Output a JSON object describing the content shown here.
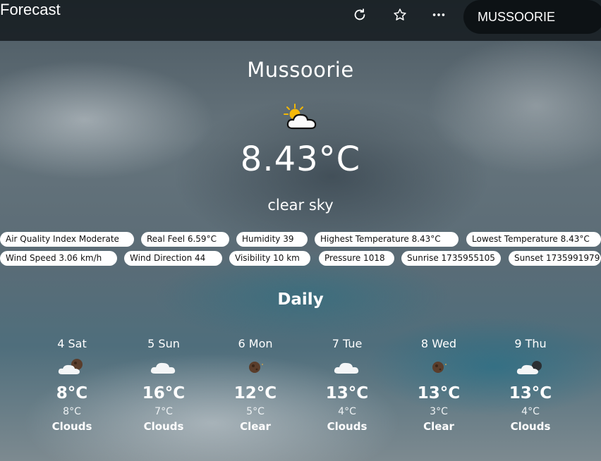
{
  "header": {
    "title": "Forecast",
    "refresh_icon": "refresh-icon",
    "favorite_icon": "star-icon",
    "more_icon": "more-dots-icon",
    "city_button": "MUSSOORIE"
  },
  "current": {
    "city": "Mussoorie",
    "icon": "sun-behind-cloud-icon",
    "temperature": "8.43°C",
    "description": "clear sky"
  },
  "details_row1": [
    {
      "label": "Air Quality Index Moderate"
    },
    {
      "label": "Real Feel 6.59°C"
    },
    {
      "label": "Humidity 39"
    },
    {
      "label": "Highest Temperature 8.43°C"
    },
    {
      "label": "Lowest Temperature 8.43°C"
    }
  ],
  "details_row2": [
    {
      "label": "Wind Speed 3.06 km/h"
    },
    {
      "label": "Wind Direction 44"
    },
    {
      "label": "Visibility 10 km"
    },
    {
      "label": "Pressure 1018"
    },
    {
      "label": "Sunrise 1735955105"
    },
    {
      "label": "Sunset 1735991979"
    }
  ],
  "daily": {
    "title": "Daily",
    "days": [
      {
        "day": "4 Sat",
        "icon": "cloud-moon-icon",
        "max": "8°C",
        "min": "8°C",
        "desc": "Clouds"
      },
      {
        "day": "5 Sun",
        "icon": "cloud-icon",
        "max": "16°C",
        "min": "7°C",
        "desc": "Clouds"
      },
      {
        "day": "6 Mon",
        "icon": "moon-icon",
        "max": "12°C",
        "min": "5°C",
        "desc": "Clear"
      },
      {
        "day": "7 Tue",
        "icon": "cloud-icon",
        "max": "13°C",
        "min": "4°C",
        "desc": "Clouds"
      },
      {
        "day": "8 Wed",
        "icon": "moon-icon",
        "max": "13°C",
        "min": "3°C",
        "desc": "Clear"
      },
      {
        "day": "9 Thu",
        "icon": "cloud-moon-icon",
        "max": "13°C",
        "min": "4°C",
        "desc": "Clouds"
      }
    ]
  }
}
